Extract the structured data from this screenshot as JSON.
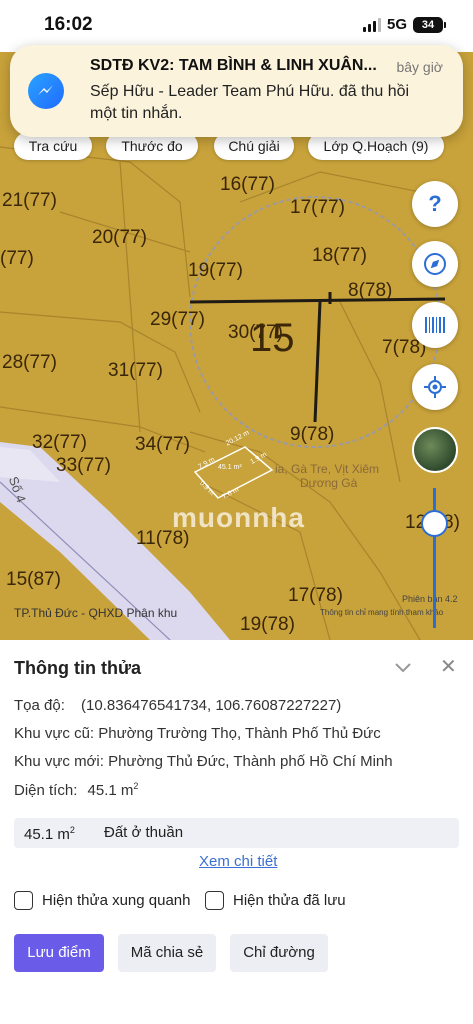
{
  "status": {
    "time": "16:02",
    "network": "5G",
    "battery": "34"
  },
  "notification": {
    "app_icon": "messenger-icon",
    "title": "SDTĐ KV2: TAM BÌNH & LINH XUÂN...",
    "time": "bây giờ",
    "body": "Sếp Hữu - Leader Team Phú Hữu. đã thu hồi một tin nhắn."
  },
  "map_tools": [
    "Tra cứu",
    "Thước đo",
    "Chú giải",
    "Lớp Q.Hoạch (9)"
  ],
  "map": {
    "parcel_labels": [
      "16(77)",
      "17(77)",
      "21(77)",
      "20(77)",
      "18(77)",
      "(77)",
      "19(77)",
      "8(78)",
      "29(77)",
      "30(77)",
      "7(78)",
      "28(77)",
      "31(77)",
      "9(78)",
      "32(77)",
      "34(77)",
      "33(77)",
      "11(78)",
      "12(78)",
      "15(87)",
      "17(78)",
      "19(78)"
    ],
    "selected_parcel": "15",
    "street_label": "Số 4",
    "road_text": "ia, Gà Tre, Vịt Xiêm",
    "road_text2": "Dương Gà",
    "dimension_labels": [
      "45.1 m²",
      "20.12 m",
      "1.9 m",
      "7.9 m",
      "0.9 m",
      "7.6 m"
    ],
    "watermark": "muonnha",
    "footer_left": "TP.Thủ Đức - QHXD Phân khu",
    "footer_right": "Thông tin chỉ mang tính tham khảo",
    "version": "Phiên bản 4.2",
    "colors": {
      "land": "#c8a23a",
      "road": "#dcd8ee",
      "accent": "#2b6fd6"
    }
  },
  "side_buttons": [
    "help-icon",
    "compass-icon",
    "barcode-icon",
    "locate-icon",
    "satellite-layer-icon"
  ],
  "sheet": {
    "title": "Thông tin thửa",
    "coordinates_label": "Tọa độ:",
    "coordinates_value": "(10.836476541734, 106.76087227227)",
    "old_area_label": "Khu vực cũ:",
    "old_area_value": "Phường Trường Thọ, Thành Phố Thủ Đức",
    "new_area_label": "Khu vực mới:",
    "new_area_value": "Phường Thủ Đức, Thành phố Hồ Chí Minh",
    "area_label": "Diện tích:",
    "area_value": "45.1 m",
    "area_unit_sup": "2",
    "land_use_area": "45.1 m",
    "land_use_sup": "2",
    "land_use_type": "Đất ở thuần",
    "detail_link": "Xem chi tiết",
    "checkbox_surrounding": "Hiện thửa xung quanh",
    "checkbox_saved": "Hiện thửa đã lưu",
    "btn_save": "Lưu điểm",
    "btn_share": "Mã chia sẻ",
    "btn_directions": "Chỉ đường"
  }
}
